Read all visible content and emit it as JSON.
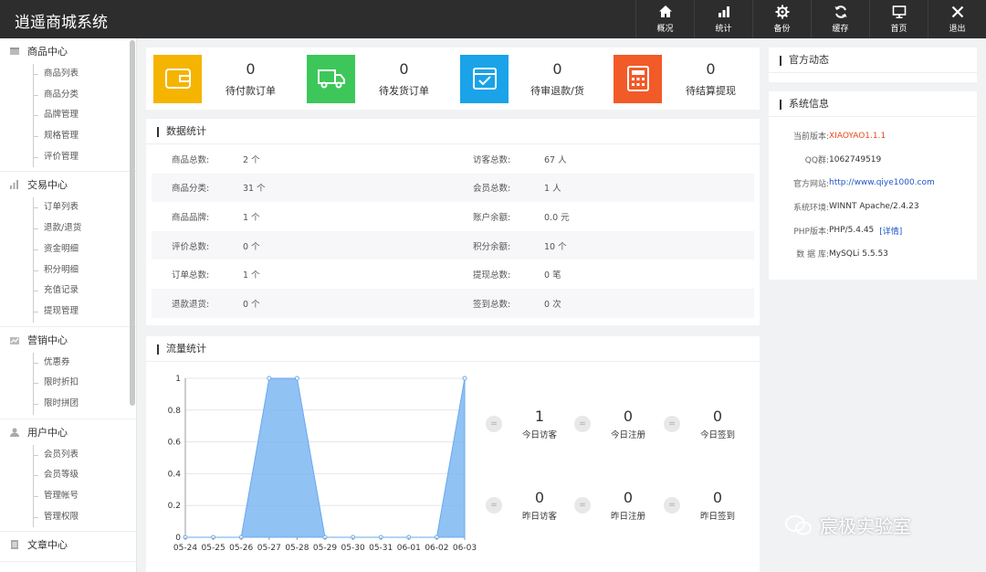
{
  "app_title": "逍遥商城系统",
  "topnav": [
    {
      "label": "概况",
      "icon": "home-icon"
    },
    {
      "label": "统计",
      "icon": "bar-chart-icon"
    },
    {
      "label": "备份",
      "icon": "gear-icon"
    },
    {
      "label": "缓存",
      "icon": "refresh-icon"
    },
    {
      "label": "首页",
      "icon": "monitor-icon"
    },
    {
      "label": "退出",
      "icon": "close-icon"
    }
  ],
  "sidebar": [
    {
      "title": "商品中心",
      "items": [
        "商品列表",
        "商品分类",
        "品牌管理",
        "规格管理",
        "评价管理"
      ]
    },
    {
      "title": "交易中心",
      "items": [
        "订单列表",
        "退款/退货",
        "资金明细",
        "积分明细",
        "充值记录",
        "提现管理"
      ]
    },
    {
      "title": "营销中心",
      "items": [
        "优惠券",
        "限时折扣",
        "限时拼团"
      ]
    },
    {
      "title": "用户中心",
      "items": [
        "会员列表",
        "会员等级",
        "管理帐号",
        "管理权限"
      ]
    },
    {
      "title": "文章中心",
      "items": []
    }
  ],
  "stats": [
    {
      "value": "0",
      "label": "待付款订单",
      "color": "#f5b400"
    },
    {
      "value": "0",
      "label": "待发货订单",
      "color": "#3dc75a"
    },
    {
      "value": "0",
      "label": "待审退款/货",
      "color": "#1aa3e8"
    },
    {
      "value": "0",
      "label": "待结算提现",
      "color": "#f25a28"
    }
  ],
  "data_stats": {
    "title": "数据统计",
    "rows": [
      [
        {
          "k": "商品总数:",
          "v": "2 个"
        },
        {
          "k": "访客总数:",
          "v": "67 人"
        }
      ],
      [
        {
          "k": "商品分类:",
          "v": "31 个"
        },
        {
          "k": "会员总数:",
          "v": "1 人"
        }
      ],
      [
        {
          "k": "商品品牌:",
          "v": "1 个"
        },
        {
          "k": "账户余额:",
          "v": "0.0 元"
        }
      ],
      [
        {
          "k": "评价总数:",
          "v": "0 个"
        },
        {
          "k": "积分余额:",
          "v": "10 个"
        }
      ],
      [
        {
          "k": "订单总数:",
          "v": "1 个"
        },
        {
          "k": "提现总数:",
          "v": "0 笔"
        }
      ],
      [
        {
          "k": "退款退货:",
          "v": "0 个"
        },
        {
          "k": "签到总数:",
          "v": "0 次"
        }
      ]
    ]
  },
  "flow": {
    "title": "流量统计",
    "today": [
      {
        "value": "1",
        "label": "今日访客"
      },
      {
        "value": "0",
        "label": "今日注册"
      },
      {
        "value": "0",
        "label": "今日签到"
      }
    ],
    "yesterday": [
      {
        "value": "0",
        "label": "昨日访客"
      },
      {
        "value": "0",
        "label": "昨日注册"
      },
      {
        "value": "0",
        "label": "昨日签到"
      }
    ]
  },
  "chart_data": {
    "type": "area",
    "x": [
      "05-24",
      "05-25",
      "05-26",
      "05-27",
      "05-28",
      "05-29",
      "05-30",
      "05-31",
      "06-01",
      "06-02",
      "06-03"
    ],
    "values": [
      0,
      0,
      0,
      1,
      1,
      0,
      0,
      0,
      0,
      0,
      1
    ],
    "ylim": [
      0,
      1
    ],
    "yticks": [
      "0",
      "0.2",
      "0.4",
      "0.6",
      "0.8",
      "1"
    ],
    "color": "#7db7f2",
    "grid": true
  },
  "official": {
    "title": "官方动态"
  },
  "sysinfo": {
    "title": "系统信息",
    "rows": [
      {
        "k": "当前版本:",
        "v": "XIAOYAO1.1.1",
        "color": "#e8481c"
      },
      {
        "k": "QQ群:",
        "v": "1062749519",
        "color": "#333"
      },
      {
        "k": "官方网站:",
        "v": "http://www.qiye1000.com",
        "color": "#1f55c8"
      },
      {
        "k": "系统环境:",
        "v": "WINNT Apache/2.4.23",
        "color": "#333"
      },
      {
        "k": "PHP版本:",
        "v": "PHP/5.4.45",
        "color": "#333",
        "extra": "[详情]"
      },
      {
        "k": "数 据 库:",
        "v": "MySQLi 5.5.53",
        "color": "#333"
      }
    ]
  },
  "watermark": "宸极实验室"
}
